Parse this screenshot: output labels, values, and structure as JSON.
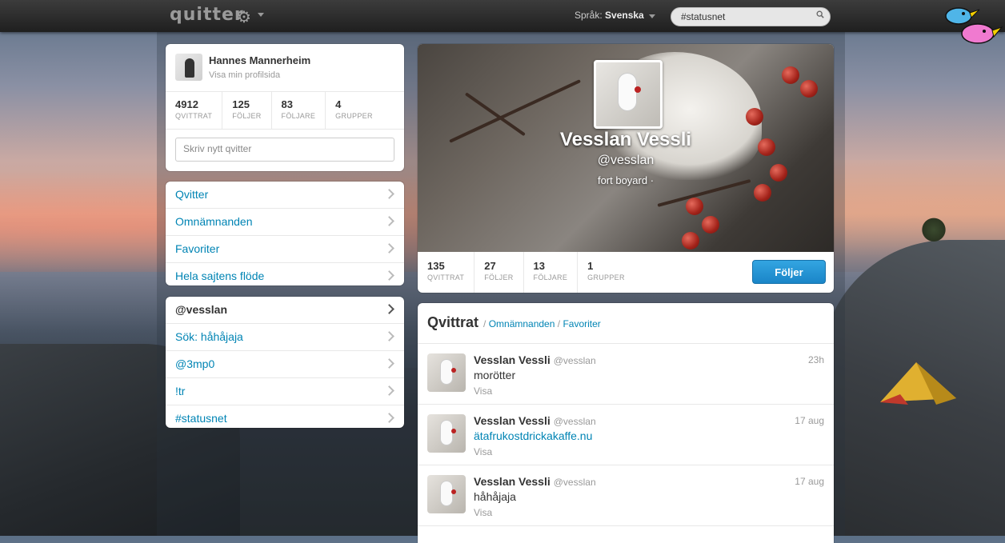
{
  "topbar": {
    "logo": "quitter",
    "language_label": "Språk:",
    "language_value": "Svenska",
    "search_value": "#statusnet"
  },
  "profile_card": {
    "name": "Hannes Mannerheim",
    "link": "Visa min profilsida",
    "stats": [
      {
        "num": "4912",
        "label": "QVITTRAT"
      },
      {
        "num": "125",
        "label": "FÖLJER"
      },
      {
        "num": "83",
        "label": "FÖLJARE"
      },
      {
        "num": "4",
        "label": "GRUPPER"
      }
    ],
    "compose_placeholder": "Skriv nytt qvitter"
  },
  "menu1": [
    "Qvitter",
    "Omnämnanden",
    "Favoriter",
    "Hela sajtens flöde"
  ],
  "menu2": [
    "@vesslan",
    "Sök: håhåjaja",
    "@3mp0",
    "!tr",
    "#statusnet"
  ],
  "header": {
    "fullname": "Vesslan Vessli",
    "handle": "@vesslan",
    "location": "fort boyard ·",
    "stats": [
      {
        "num": "135",
        "label": "QVITTRAT"
      },
      {
        "num": "27",
        "label": "FÖLJER"
      },
      {
        "num": "13",
        "label": "FÖLJARE"
      },
      {
        "num": "1",
        "label": "GRUPPER"
      }
    ],
    "follow_button": "Följer"
  },
  "timeline": {
    "title": "Qvittrat",
    "sep1": "/",
    "link1": "Omnämnanden",
    "sep2": "/",
    "link2": "Favoriter",
    "tweets": [
      {
        "name": "Vesslan Vessli",
        "handle": "@vesslan",
        "time": "23h",
        "text": "morötter",
        "action": "Visa"
      },
      {
        "name": "Vesslan Vessli",
        "handle": "@vesslan",
        "time": "17 aug",
        "text": "ätafrukostdrickakaffe.nu",
        "action": "Visa"
      },
      {
        "name": "Vesslan Vessli",
        "handle": "@vesslan",
        "time": "17 aug",
        "text": "håhåjaja",
        "action": "Visa"
      }
    ]
  },
  "colors": {
    "link": "#0084b4",
    "accent_button": "#1a85c8"
  }
}
